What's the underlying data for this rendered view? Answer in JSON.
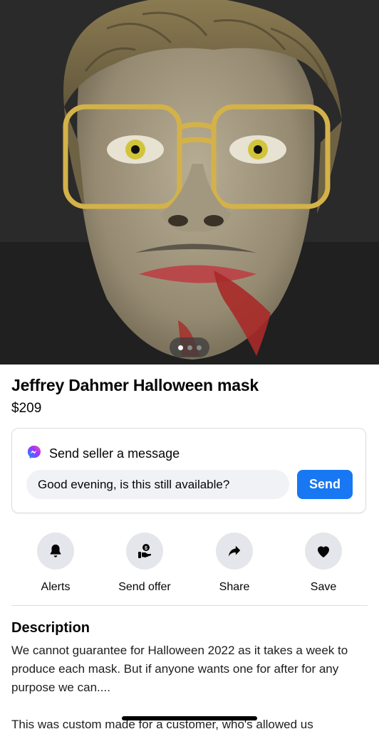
{
  "listing": {
    "title": "Jeffrey Dahmer Halloween mask",
    "price": "$209",
    "photo_count": 3,
    "active_photo": 1
  },
  "message": {
    "header": "Send seller a message",
    "input_value": "Good evening, is this still available?",
    "send_label": "Send",
    "icon": "messenger-icon"
  },
  "actions": [
    {
      "label": "Alerts",
      "icon": "bell-icon"
    },
    {
      "label": "Send offer",
      "icon": "offer-icon"
    },
    {
      "label": "Share",
      "icon": "share-icon"
    },
    {
      "label": "Save",
      "icon": "heart-icon"
    }
  ],
  "description": {
    "heading": "Description",
    "paragraphs": [
      "We cannot guarantee for Halloween 2022 as it takes a week to produce each mask.  But if anyone wants one for after for any purpose we can....",
      "This was custom made for a customer, who's allowed us"
    ]
  },
  "colors": {
    "accent": "#1877f2",
    "button_bg": "#e4e6eb",
    "input_bg": "#f0f2f5"
  }
}
